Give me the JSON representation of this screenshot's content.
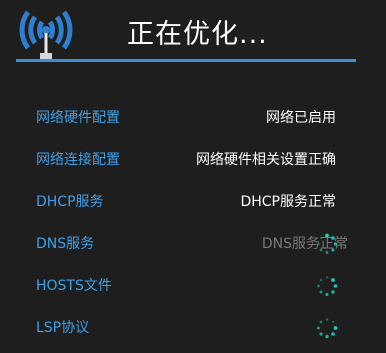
{
  "header": {
    "title": "正在优化..."
  },
  "rows": [
    {
      "label": "网络硬件配置",
      "status": "网络已启用",
      "state": "done"
    },
    {
      "label": "网络连接配置",
      "status": "网络硬件相关设置正确",
      "state": "done"
    },
    {
      "label": "DHCP服务",
      "status": "DHCP服务正常",
      "state": "done"
    },
    {
      "label": "DNS服务",
      "status": "DNS服务正常",
      "state": "loading"
    },
    {
      "label": "HOSTS文件",
      "status": "",
      "state": "loading"
    },
    {
      "label": "LSP协议",
      "status": "",
      "state": "loading"
    }
  ],
  "colors": {
    "accent": "#3fa0e8",
    "background": "#1e1e1e",
    "spinner": "#19d0b8"
  }
}
